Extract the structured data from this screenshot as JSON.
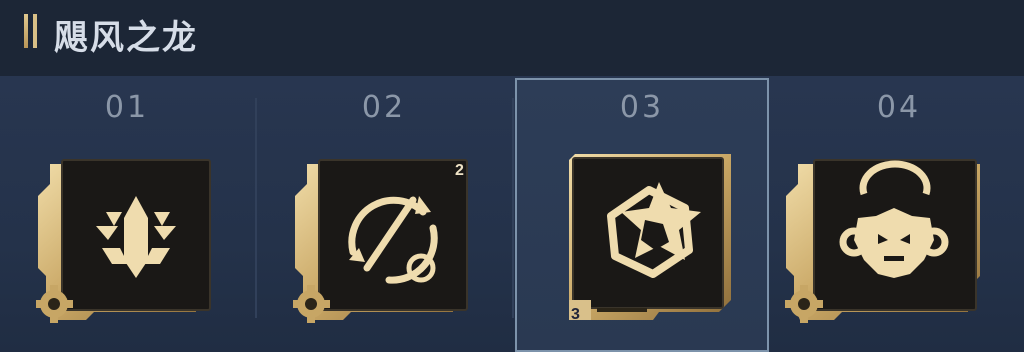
{
  "header": {
    "title": "飓风之龙"
  },
  "slots": [
    {
      "number": "01",
      "icon": "arrow-triangle-emblem-icon",
      "selected": false,
      "badge": ""
    },
    {
      "number": "02",
      "icon": "arrow-cycle-target-icon",
      "selected": false,
      "badge": "2"
    },
    {
      "number": "03",
      "icon": "star-hexagon-emblem-icon",
      "selected": true,
      "level": "3"
    },
    {
      "number": "04",
      "icon": "dragon-head-icon",
      "selected": false,
      "badge": ""
    }
  ],
  "colors": {
    "gold": "#d9c08a",
    "gold_dark": "#9a7a44",
    "bg": "#1a2433",
    "selected_border": "#7d93ab"
  }
}
